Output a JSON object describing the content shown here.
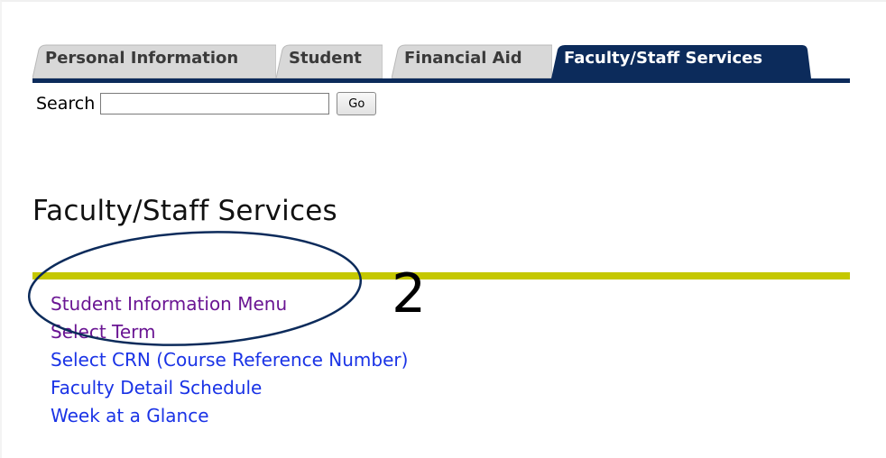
{
  "tabs": [
    {
      "label": "Personal Information",
      "active": false
    },
    {
      "label": "Student",
      "active": false
    },
    {
      "label": "Financial Aid",
      "active": false
    },
    {
      "label": "Faculty/Staff Services",
      "active": true
    }
  ],
  "search": {
    "label": "Search",
    "value": "",
    "placeholder": "",
    "button_label": "Go"
  },
  "page": {
    "title": "Faculty/Staff Services"
  },
  "menu_links": [
    {
      "label": "Student Information Menu",
      "state": "visited"
    },
    {
      "label": "Select Term",
      "state": "visited"
    },
    {
      "label": "Select CRN (Course Reference Number)",
      "state": "normal"
    },
    {
      "label": "Faculty Detail Schedule",
      "state": "normal"
    },
    {
      "label": "Week at a Glance",
      "state": "normal"
    }
  ],
  "annotation": {
    "step_number": "2",
    "shape": "ellipse-outline"
  },
  "colors": {
    "active_tab": "#0c2b5b",
    "inactive_tab": "#d8d8d8",
    "title_rule": "#c5c800",
    "visited_link": "#6a1593",
    "link": "#1a33e6",
    "annotation": "#0c2b5b"
  }
}
